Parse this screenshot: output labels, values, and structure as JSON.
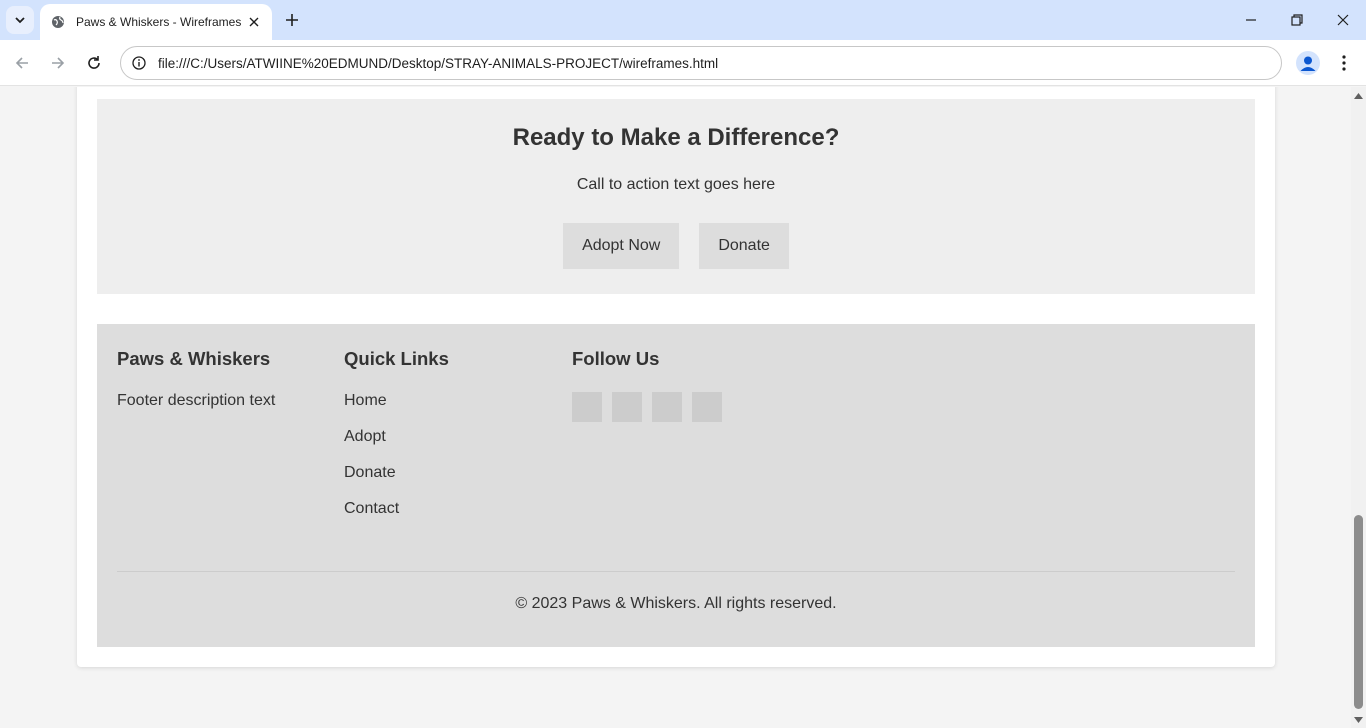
{
  "browser": {
    "tab_title": "Paws & Whiskers - Wireframes",
    "url": "file:///C:/Users/ATWIINE%20EDMUND/Desktop/STRAY-ANIMALS-PROJECT/wireframes.html"
  },
  "cta": {
    "title": "Ready to Make a Difference?",
    "text": "Call to action text goes here",
    "adopt_label": "Adopt Now",
    "donate_label": "Donate"
  },
  "footer": {
    "brand_title": "Paws & Whiskers",
    "description": "Footer description text",
    "quick_links_title": "Quick Links",
    "links": [
      "Home",
      "Adopt",
      "Donate",
      "Contact"
    ],
    "follow_title": "Follow Us",
    "social_count_icons": [
      "social-icon-1",
      "social-icon-2",
      "social-icon-3",
      "social-icon-4"
    ],
    "copyright": "© 2023 Paws & Whiskers. All rights reserved."
  }
}
